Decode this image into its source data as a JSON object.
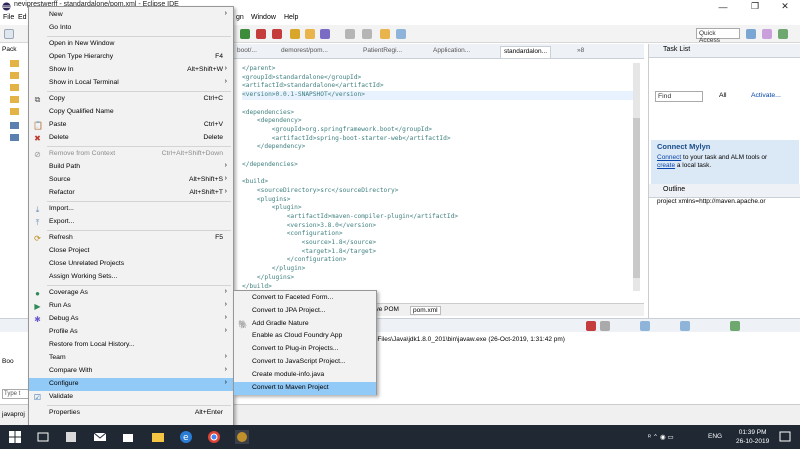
{
  "window": {
    "title": "neviprestwerff - standardalone/pom.xml - Eclipse IDE",
    "minimize_glyph": "—",
    "restore_glyph": "❐",
    "close_glyph": "✕"
  },
  "menubar": {
    "file": "File",
    "edit": "Ed",
    "navigate": "gn",
    "window": "Window",
    "help": "Help"
  },
  "toolbar": {
    "quick_access": "Quick Access"
  },
  "left_pane": {
    "tab_label": "Pack"
  },
  "editor_tabs": [
    {
      "label": "boot/..."
    },
    {
      "label": "demorest/pom..."
    },
    {
      "label": "PatientRegi..."
    },
    {
      "label": "Application..."
    },
    {
      "label": "standardalon..."
    },
    {
      "label": "»8"
    }
  ],
  "code_lines": [
    {
      "indent": "",
      "text": "</parent>",
      "kind": "tag"
    },
    {
      "indent": "",
      "text": "<groupId>standardalone</groupId>",
      "kind": "tag"
    },
    {
      "indent": "",
      "text": "<artifactId>standardalone</artifactId>",
      "kind": "tag"
    },
    {
      "indent": "",
      "text": "<version>0.0.1-SNAPSHOT</version>",
      "kind": "tag",
      "hl": true
    },
    {
      "indent": "",
      "text": "",
      "kind": "tag"
    },
    {
      "indent": "",
      "text": "<dependencies>",
      "kind": "tag"
    },
    {
      "indent": "    ",
      "text": "<dependency>",
      "kind": "tag"
    },
    {
      "indent": "        ",
      "text": "<groupId>org.springframework.boot</groupId>",
      "kind": "tag"
    },
    {
      "indent": "        ",
      "text": "<artifactId>spring-boot-starter-web</artifactId>",
      "kind": "tag"
    },
    {
      "indent": "    ",
      "text": "</dependency>",
      "kind": "tag"
    },
    {
      "indent": "",
      "text": "",
      "kind": "tag"
    },
    {
      "indent": "",
      "text": "</dependencies>",
      "kind": "tag"
    },
    {
      "indent": "",
      "text": "",
      "kind": "tag"
    },
    {
      "indent": "",
      "text": "<build>",
      "kind": "tag"
    },
    {
      "indent": "    ",
      "text": "<sourceDirectory>src</sourceDirectory>",
      "kind": "tag"
    },
    {
      "indent": "    ",
      "text": "<plugins>",
      "kind": "tag"
    },
    {
      "indent": "        ",
      "text": "<plugin>",
      "kind": "tag"
    },
    {
      "indent": "            ",
      "text": "<artifactId>maven-compiler-plugin</artifactId>",
      "kind": "tag"
    },
    {
      "indent": "            ",
      "text": "<version>3.8.0</version>",
      "kind": "tag"
    },
    {
      "indent": "            ",
      "text": "<configuration>",
      "kind": "tag"
    },
    {
      "indent": "                ",
      "text": "<source>1.8</source>",
      "kind": "tag"
    },
    {
      "indent": "                ",
      "text": "<target>1.8</target>",
      "kind": "tag"
    },
    {
      "indent": "            ",
      "text": "</configuration>",
      "kind": "tag"
    },
    {
      "indent": "        ",
      "text": "</plugin>",
      "kind": "tag"
    },
    {
      "indent": "    ",
      "text": "</plugins>",
      "kind": "tag"
    },
    {
      "indent": "",
      "text": "</build>",
      "kind": "tag"
    }
  ],
  "editor_bottom_tabs": {
    "effective": "ive POM",
    "pom": "pom.xml"
  },
  "console": {
    "path": "n Files\\Java\\jdk1.8.0_201\\bin\\javaw.exe (26-Oct-2019, 1:31:42 pm)",
    "left_label": "Boo",
    "type_box": "Type t"
  },
  "statusbar": {
    "text": "javaproj"
  },
  "task_list": {
    "title": "Task List",
    "find": "Find",
    "all": "All",
    "activate": "Activate..."
  },
  "mylyn": {
    "title": "Connect Mylyn",
    "line1_link": "Connect",
    "line1_rest": " to your task and ALM tools or",
    "line2_link": "create",
    "line2_rest": " a local task."
  },
  "outline": {
    "title": "Outline",
    "item": "project xmlns=http://maven.apache.or"
  },
  "context_menu": [
    {
      "label": "New",
      "shortcut": "",
      "arrow": true,
      "icon": ""
    },
    {
      "label": "Go Into",
      "shortcut": "",
      "arrow": false,
      "icon": ""
    },
    {
      "sep": true
    },
    {
      "label": "Open in New Window",
      "shortcut": "",
      "arrow": false,
      "icon": ""
    },
    {
      "label": "Open Type Hierarchy",
      "shortcut": "F4",
      "arrow": false,
      "icon": ""
    },
    {
      "label": "Show In",
      "shortcut": "Alt+Shift+W",
      "arrow": true,
      "icon": ""
    },
    {
      "label": "Show in Local Terminal",
      "shortcut": "",
      "arrow": true,
      "icon": ""
    },
    {
      "sep": true
    },
    {
      "label": "Copy",
      "shortcut": "Ctrl+C",
      "arrow": false,
      "icon": "copy"
    },
    {
      "label": "Copy Qualified Name",
      "shortcut": "",
      "arrow": false,
      "icon": ""
    },
    {
      "label": "Paste",
      "shortcut": "Ctrl+V",
      "arrow": false,
      "icon": "paste"
    },
    {
      "label": "Delete",
      "shortcut": "Delete",
      "arrow": false,
      "icon": "delete"
    },
    {
      "sep": true
    },
    {
      "label": "Remove from Context",
      "shortcut": "Ctrl+Alt+Shift+Down",
      "arrow": false,
      "icon": "remove",
      "disabled": true
    },
    {
      "label": "Build Path",
      "shortcut": "",
      "arrow": true,
      "icon": ""
    },
    {
      "label": "Source",
      "shortcut": "Alt+Shift+S",
      "arrow": true,
      "icon": ""
    },
    {
      "label": "Refactor",
      "shortcut": "Alt+Shift+T",
      "arrow": true,
      "icon": ""
    },
    {
      "sep": true
    },
    {
      "label": "Import...",
      "shortcut": "",
      "arrow": false,
      "icon": "import"
    },
    {
      "label": "Export...",
      "shortcut": "",
      "arrow": false,
      "icon": "export"
    },
    {
      "sep": true
    },
    {
      "label": "Refresh",
      "shortcut": "F5",
      "arrow": false,
      "icon": "refresh"
    },
    {
      "label": "Close Project",
      "shortcut": "",
      "arrow": false,
      "icon": ""
    },
    {
      "label": "Close Unrelated Projects",
      "shortcut": "",
      "arrow": false,
      "icon": ""
    },
    {
      "label": "Assign Working Sets...",
      "shortcut": "",
      "arrow": false,
      "icon": ""
    },
    {
      "sep": true
    },
    {
      "label": "Coverage As",
      "shortcut": "",
      "arrow": true,
      "icon": "coverage"
    },
    {
      "label": "Run As",
      "shortcut": "",
      "arrow": true,
      "icon": "run"
    },
    {
      "label": "Debug As",
      "shortcut": "",
      "arrow": true,
      "icon": "debug"
    },
    {
      "label": "Profile As",
      "shortcut": "",
      "arrow": true,
      "icon": ""
    },
    {
      "label": "Restore from Local History...",
      "shortcut": "",
      "arrow": false,
      "icon": ""
    },
    {
      "label": "Team",
      "shortcut": "",
      "arrow": true,
      "icon": ""
    },
    {
      "label": "Compare With",
      "shortcut": "",
      "arrow": true,
      "icon": ""
    },
    {
      "label": "Configure",
      "shortcut": "",
      "arrow": true,
      "icon": "",
      "selected": true
    },
    {
      "label": "Validate",
      "shortcut": "",
      "arrow": false,
      "icon": "check"
    },
    {
      "sep": true
    },
    {
      "label": "Properties",
      "shortcut": "Alt+Enter",
      "arrow": false,
      "icon": ""
    }
  ],
  "submenu": [
    {
      "label": "Convert to Faceted Form...",
      "icon": ""
    },
    {
      "label": "Convert to JPA Project...",
      "icon": ""
    },
    {
      "label": "Add Gradle Nature",
      "icon": "gradle"
    },
    {
      "label": "Enable as Cloud Foundry App",
      "icon": ""
    },
    {
      "label": "Convert to Plug-in Projects...",
      "icon": ""
    },
    {
      "label": "Convert to JavaScript Project...",
      "icon": ""
    },
    {
      "label": "Create module-info.java",
      "icon": ""
    },
    {
      "label": "Convert to Maven Project",
      "icon": "",
      "selected": true
    }
  ],
  "taskbar": {
    "tray_text": "ENG",
    "time": "01:39 PM",
    "date": "26-10-2019"
  },
  "colors": {
    "selection": "#91c9f7",
    "xml_tag": "#3f7f7f",
    "taskbar": "#1f2833"
  }
}
